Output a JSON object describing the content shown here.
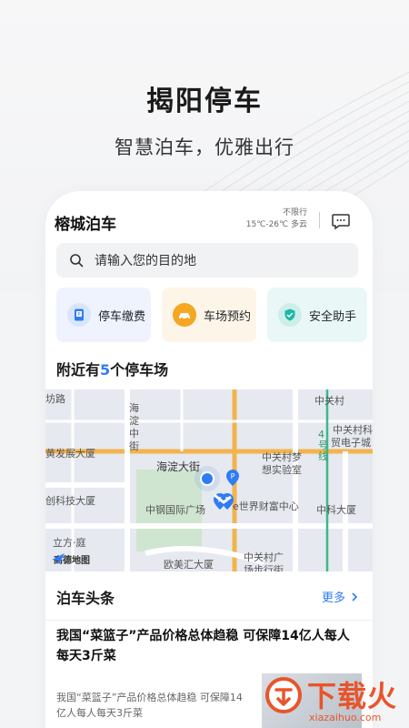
{
  "hero": {
    "title": "揭阳停车",
    "subtitle": "智慧泊车，优雅出行"
  },
  "app": {
    "name": "榕城泊车",
    "weather": {
      "restriction": "不限行",
      "forecast": "15℃-26℃ 多云"
    },
    "message_icon": "chat-bubble-icon"
  },
  "search": {
    "placeholder": "请输入您的目的地",
    "icon": "search-icon"
  },
  "services": [
    {
      "label": "停车缴费",
      "icon": "payment-icon",
      "color": "#2f7cf6"
    },
    {
      "label": "车场预约",
      "icon": "reservation-icon",
      "color": "#f5a623"
    },
    {
      "label": "安全助手",
      "icon": "shield-icon",
      "color": "#1cb8a5"
    }
  ],
  "nearby": {
    "prefix": "附近有",
    "count": "5",
    "suffix": "个停车场"
  },
  "map": {
    "labels": [
      "坊路",
      "海淀中街",
      "中关村",
      "中关村科",
      "贸电子城",
      "黄发展大厦",
      "海淀大街",
      "中关村梦",
      "想实验室",
      "4号线",
      "创科技大厦",
      "中钢国际广场",
      "e世界财富中心",
      "中科大厦",
      "立方·庭",
      "中关村广",
      "场步行街",
      "欧美汇大厦"
    ],
    "brand": "高德地图",
    "parking_count_markers": 4
  },
  "news": {
    "title": "泊车头条",
    "more_label": "更多",
    "article_title": "我国“菜篮子”产品价格总体趋稳 可保障14亿人每人每天3斤菜",
    "article_summary": "我国“菜篮子”产品价格总体趋稳 可保障14亿人每人每天3斤菜"
  },
  "watermark": {
    "text": "下载火",
    "url": "xiazaihuo.com"
  },
  "colors": {
    "accent": "#2f7cf6",
    "watermark": "#e8552b"
  }
}
